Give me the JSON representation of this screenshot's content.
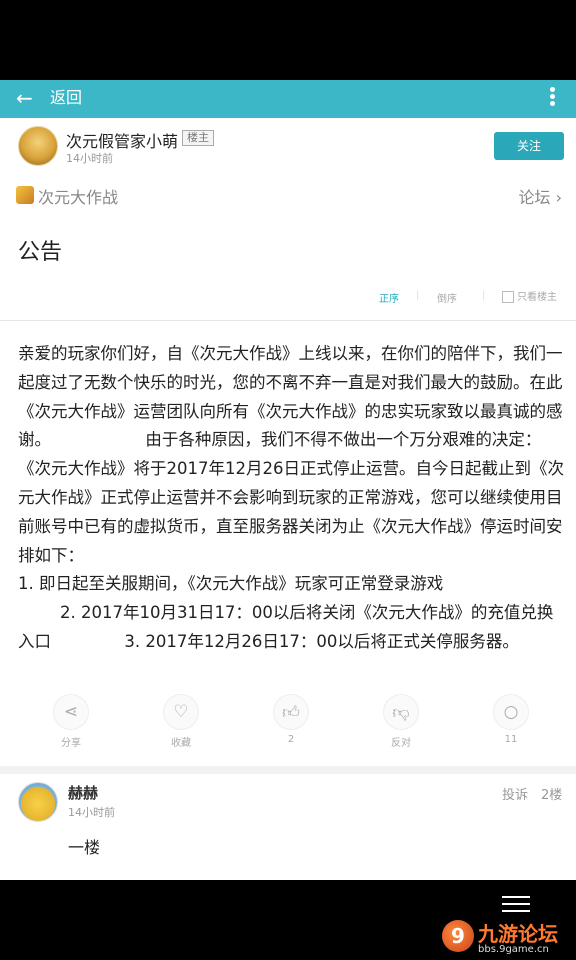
{
  "appbar": {
    "back_label": "返回"
  },
  "author": {
    "name": "次元假管家小萌",
    "badge": "楼主",
    "time": "14小时前",
    "follow_label": "关注"
  },
  "forum": {
    "name": "次元大作战",
    "link": "论坛 ›"
  },
  "post": {
    "title": "公告",
    "paragraphs": [
      "亲爱的玩家你们好，自《次元大作战》上线以来，在你们的陪伴下，我们一起度过了无数个快乐的时光，您的不离不弃一直是对我们最大的鼓励。在此《次元大作战》运营团队向所有《次元大作战》的忠实玩家致以最真诚的感谢。                  由于各种原因，我们不得不做出一个万分艰难的决定：《次元大作战》将于2017年12月26日正式停止运营。自今日起截止到《次元大作战》正式停止运营并不会影响到玩家的正常游戏，您可以继续使用目前账号中已有的虚拟货币，直至服务器关闭为止《次元大作战》停运时间安排如下：",
      "1. 即日起至关服期间，《次元大作战》玩家可正常登录游戏",
      "        2. 2017年10月31日17：00以后将关闭《次元大作战》的充值兑换入口              3. 2017年12月26日17：00以后将正式关停服务器。"
    ]
  },
  "sort": {
    "correct": "正序",
    "reverse": "倒序",
    "only_owner": "只看楼主"
  },
  "actions": {
    "share": "分享",
    "favorite": "收藏",
    "likes": "2",
    "dislike": "反对",
    "comments": "11"
  },
  "comment": {
    "name": "赫赫",
    "time": "14小时前",
    "report": "投诉",
    "floor": "2楼",
    "text": "一楼"
  },
  "watermark": {
    "title": "九游论坛",
    "url": "bbs.9game.cn",
    "logo_char": "9"
  },
  "colors": {
    "accent": "#3bb7c7",
    "button": "#2aa7b9"
  }
}
